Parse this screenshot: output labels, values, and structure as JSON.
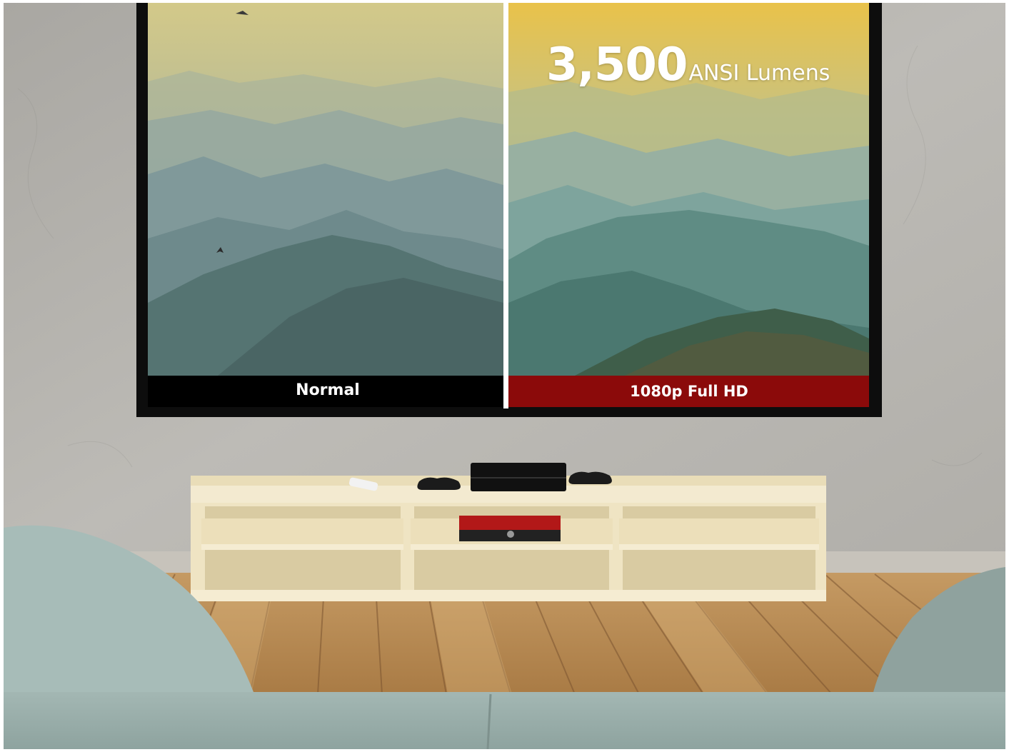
{
  "screen": {
    "left_label": "Normal",
    "right_label": "1080p Full HD",
    "lumens_value": "3,500",
    "lumens_unit": "ANSI Lumens"
  },
  "colors": {
    "wall": "#b5b3ae",
    "screen_frame": "#0d0d0d",
    "normal_bar": "#000000",
    "hd_bar": "#8b0a0a",
    "cabinet": "#f0e6c6",
    "floor": "#c89a60",
    "sofa": "#9bb1ad"
  }
}
